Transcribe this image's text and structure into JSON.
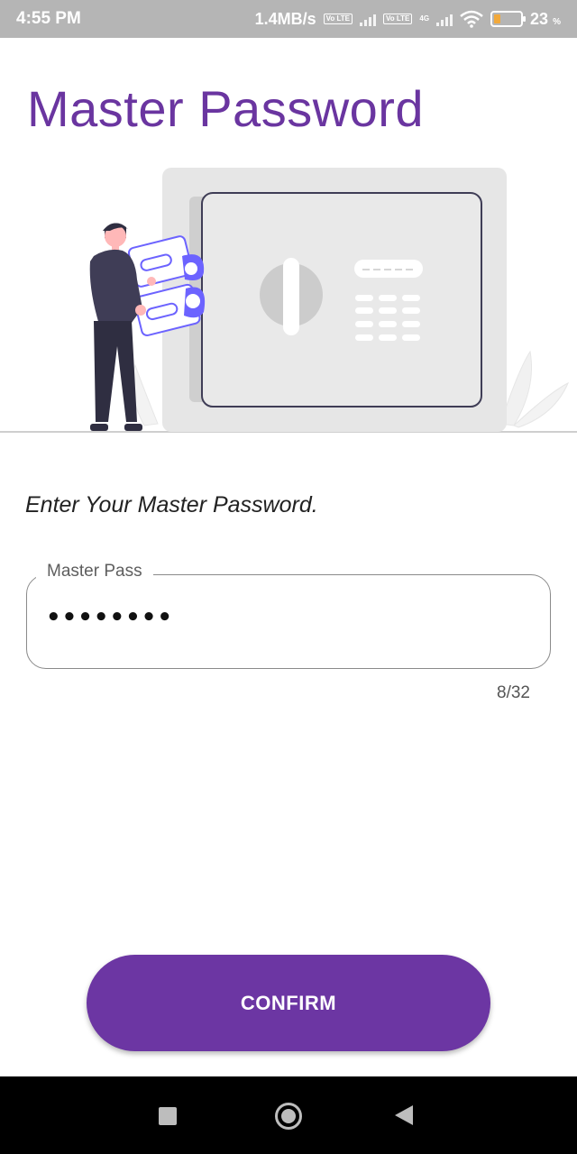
{
  "status_bar": {
    "time": "4:55 PM",
    "network_speed": "1.4MB/s",
    "volte_badge_1": "Vo LTE",
    "volte_badge_2": "Vo LTE",
    "network_type": "4G",
    "battery_percent": "23",
    "battery_symbol": "%"
  },
  "header": {
    "title": "Master Password"
  },
  "form": {
    "prompt": "Enter Your Master Password.",
    "password_field": {
      "label": "Master Pass",
      "masked_value": "••••••••",
      "counter": "8/32"
    },
    "confirm_label": "CONFIRM"
  },
  "colors": {
    "accent": "#6c36a3",
    "title": "#6a35a0",
    "illustration_accent": "#6c63ff"
  },
  "icons": [
    "wifi-icon",
    "signal-icon",
    "battery-icon",
    "safe-illustration",
    "recent-apps-icon",
    "home-icon",
    "back-icon"
  ]
}
